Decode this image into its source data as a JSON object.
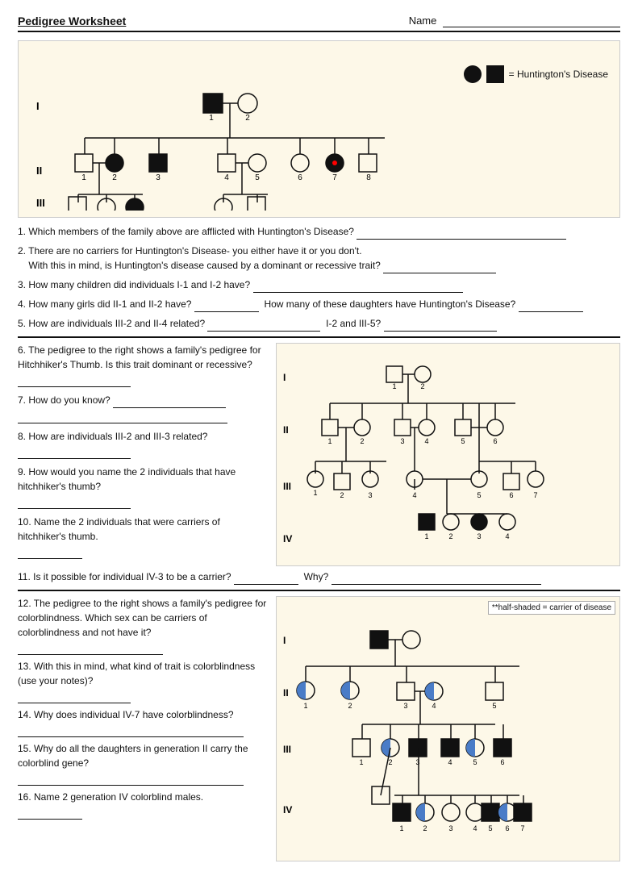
{
  "header": {
    "title": "Pedigree Worksheet",
    "name_label": "Name"
  },
  "legend": {
    "equals": "= Huntington's Disease"
  },
  "questions": {
    "q1": "1. Which members of the family above are afflicted with Huntington's Disease?",
    "q2a": "2. There are no carriers for Huntington's Disease- you either have it or you don't.",
    "q2b": "With this in mind, is Huntington's disease caused by a dominant or recessive trait?",
    "q3": "3. How many children did individuals I-1 and I-2 have?",
    "q4a": "4. How many girls did II-1 and II-2 have?",
    "q4b": "How many of these daughters have Huntington's Disease?",
    "q5a": "5. How are individuals III-2 and II-4 related?",
    "q5b": "I-2 and III-5?",
    "q6": "6. The pedigree to the right shows a family's pedigree for Hitchhiker's Thumb. Is this trait dominant or recessive?",
    "q7": "7. How do you know?",
    "q8": "8. How are individuals III-2 and III-3 related?",
    "q9": "9. How would you name the 2 individuals that have hitchhiker's thumb?",
    "q10": "10. Name the 2 individuals that were carriers of hitchhiker's thumb.",
    "q11": "11. Is it possible for individual IV-3 to be a carrier?",
    "q11b": "Why?",
    "q12": "12. The pedigree to the right shows a family's pedigree for colorblindness.  Which sex can be carriers of colorblindness and not have it?",
    "q13": "13. With this in mind, what kind of trait is colorblindness (use your notes)?",
    "q14": "14. Why does individual IV-7 have colorblindness?",
    "q15": "15. Why do all the daughters in generation II carry the colorblind gene?",
    "q16": "16. Name 2 generation IV colorblind males.",
    "half_shaded_note": "**half-shaded = carrier of disease",
    "roman_I": "I",
    "roman_II": "II",
    "roman_III": "III",
    "roman_IV": "IV"
  }
}
